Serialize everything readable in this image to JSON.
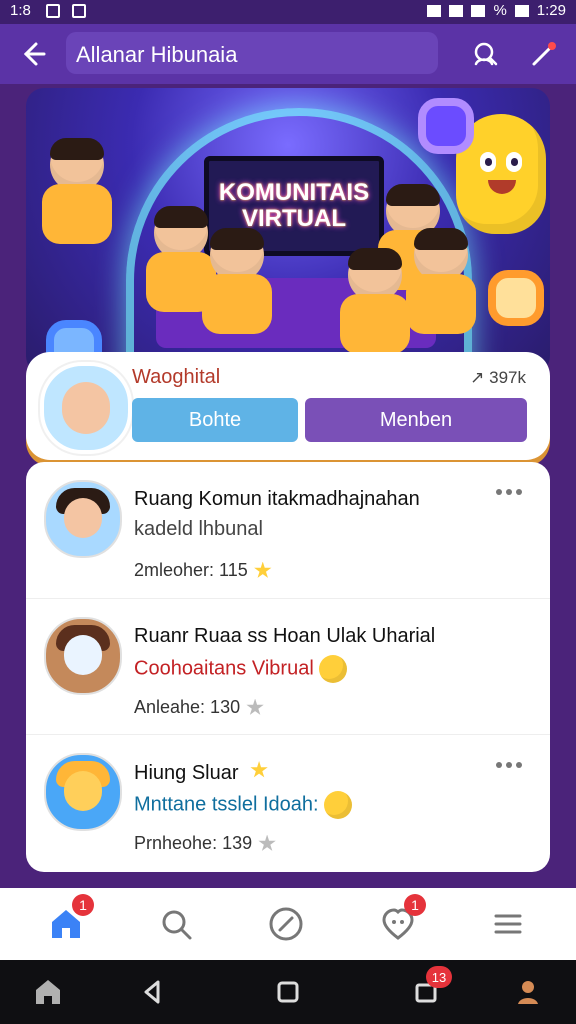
{
  "status_bar": {
    "time_left": "1:8",
    "time_right": "1:29",
    "battery_text": "%"
  },
  "app_bar": {
    "title": "Allanar Hibunaia",
    "icons": [
      "back-arrow-icon",
      "search-user-icon",
      "magic-wand-icon"
    ]
  },
  "hero": {
    "screen_text": "KOMUNITAIS\nVIRTUAL"
  },
  "profile_card": {
    "name": "Waoghital",
    "count": "↗ 397k",
    "buttons": {
      "primary": "Bohte",
      "secondary": "Menben"
    }
  },
  "list": {
    "items": [
      {
        "title": "Ruang Komun itakmadhajnahan",
        "subtitle": "kadeld lhbunal",
        "meta": "2mleoher: 115"
      },
      {
        "title": "Ruanr Ruaa ss Hoan Ulak Uharial",
        "subtitle": "Coohoaitans Vibrual",
        "meta": "Anleahe: 130"
      },
      {
        "title": "Hiung Sluar",
        "subtitle": "Mnttane tsslel Idoah:",
        "meta": "Prnheohe: 139"
      }
    ]
  },
  "bottom_nav": {
    "badges": {
      "home": "1",
      "notifications": "1"
    }
  },
  "system_nav": {
    "badge": "13"
  },
  "colors": {
    "primary_purple": "#5b33a6",
    "button_blue": "#5fb3e6",
    "button_purple": "#7a50b7",
    "badge_red": "#e5333b"
  }
}
